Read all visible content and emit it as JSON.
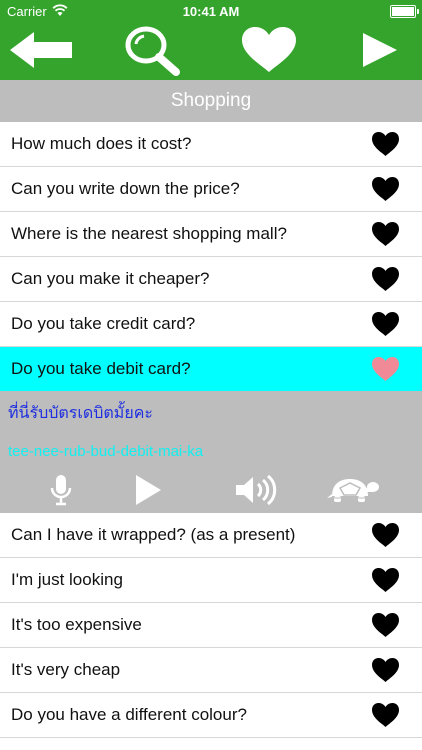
{
  "status": {
    "carrier": "Carrier",
    "time": "10:41 AM"
  },
  "toolbar": {
    "back_icon": "arrow-left-icon",
    "search_icon": "search-icon",
    "favorite_icon": "heart-icon",
    "play_icon": "play-icon"
  },
  "section": {
    "title": "Shopping"
  },
  "phrases_top": [
    {
      "text": "How much does it cost?"
    },
    {
      "text": "Can you write down the price?"
    },
    {
      "text": "Where is the nearest shopping mall?"
    },
    {
      "text": "Can you make it cheaper?"
    },
    {
      "text": "Do you take credit card?"
    }
  ],
  "selected": {
    "text": "Do you take debit card?",
    "thai": "ที่นี่รับบัตรเดบิตมั้ยคะ",
    "romanization": "tee-nee-rub-bud-debit-mai-ka"
  },
  "phrases_bottom": [
    {
      "text": "Can I have it wrapped? (as a present)"
    },
    {
      "text": "I'm just looking"
    },
    {
      "text": "It's too expensive"
    },
    {
      "text": "It's very cheap"
    },
    {
      "text": "Do you have a different colour?"
    }
  ],
  "colors": {
    "toolbar_green": "#35a42c",
    "selected_row": "#00ffff",
    "detail_panel": "#bdbdbd",
    "favorite_heart_selected": "#f08a96",
    "thai_text": "#1d2ee0",
    "romanization_text": "#12f0f0"
  }
}
